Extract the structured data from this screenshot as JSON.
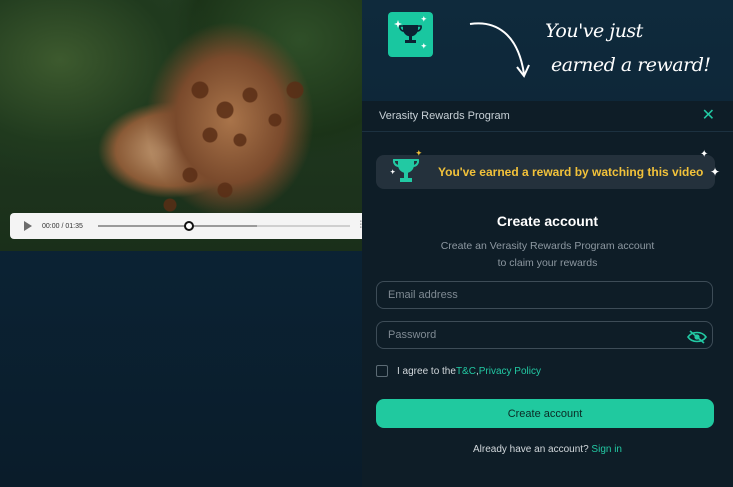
{
  "video": {
    "current_time": "00:00",
    "separator": "/",
    "duration": "01:35",
    "progress_fraction": 0.36,
    "buffered_fraction": 0.63
  },
  "promo": {
    "line1": "You've just",
    "line2": "earned a reward!",
    "tile_color": "#19c7a0"
  },
  "modal": {
    "title": "Verasity Rewards Program",
    "banner_text": "You've earned a reward by watching this video",
    "heading": "Create account",
    "sub_line1": "Create an Verasity Rewards Program account",
    "sub_line2": "to claim your rewards",
    "email_placeholder": "Email address",
    "password_placeholder": "Password",
    "agree_prefix": "I agree to the ",
    "tc_link": "T&C",
    "agree_sep": ", ",
    "privacy_link": "Privacy Policy",
    "cta_label": "Create account",
    "signin_prefix": "Already have an account? ",
    "signin_link": "Sign in",
    "accent": "#22c9a3",
    "banner_text_color": "#f2c23a"
  }
}
